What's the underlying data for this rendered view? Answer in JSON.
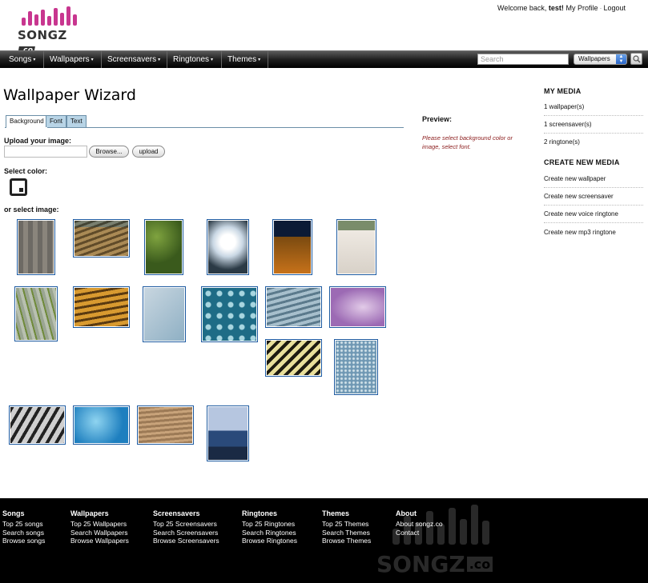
{
  "brand": {
    "logo_text": "SONGZ",
    "logo_suffix": ".co",
    "accent": "#cc3399"
  },
  "userbar": {
    "welcome": "Welcome back,",
    "username": "test!",
    "profile": "My Profile",
    "sep": "·",
    "logout": "Logout"
  },
  "nav": {
    "items": [
      {
        "label": "Songs",
        "caret": "▾"
      },
      {
        "label": "Wallpapers",
        "caret": "▾"
      },
      {
        "label": "Screensavers",
        "caret": "▾"
      },
      {
        "label": "Ringtones",
        "caret": "▾"
      },
      {
        "label": "Themes",
        "caret": "▾"
      }
    ],
    "search_placeholder": "Search",
    "search_category": "Wallpapers",
    "search_icon": "magnifier-icon"
  },
  "main": {
    "title": "Wallpaper Wizard",
    "tabs": [
      {
        "label": "Background",
        "active": true
      },
      {
        "label": "Font",
        "active": false
      },
      {
        "label": "Text",
        "active": false
      }
    ],
    "upload_label": "Upload your image:",
    "browse_label": "Browse...",
    "upload_btn": "upload",
    "select_color_label": "Select color:",
    "select_image_label": "or select image:"
  },
  "preview": {
    "title": "Preview:",
    "message": "Please select background color or image, select font."
  },
  "sidebar": {
    "my_media_title": "MY MEDIA",
    "my_media": [
      "1 wallpaper(s)",
      "1 screensaver(s)",
      "2 ringtone(s)"
    ],
    "create_title": "CREATE NEW MEDIA",
    "create": [
      "Create new wallpaper",
      "Create new screensaver",
      "Create new voice ringtone",
      "Create new mp3 ringtone"
    ]
  },
  "footer": {
    "columns": [
      {
        "title": "Songs",
        "links": [
          "Top 25 songs",
          "Search songs",
          "Browse songs"
        ]
      },
      {
        "title": "Wallpapers",
        "links": [
          "Top 25 Wallpapers",
          "Search Wallpapers",
          "Browse Wallpapers"
        ]
      },
      {
        "title": "Screensavers",
        "links": [
          "Top 25 Screensavers",
          "Search Screensavers",
          "Browse Screensavers"
        ]
      },
      {
        "title": "Ringtones",
        "links": [
          "Top 25 Ringtones",
          "Search Ringtones",
          "Browse Ringtones"
        ]
      },
      {
        "title": "Themes",
        "links": [
          "Top 25 Themes",
          "Search Themes",
          "Browse Themes"
        ]
      },
      {
        "title": "About",
        "links": [
          "About songz.co",
          "Contact"
        ]
      }
    ]
  }
}
